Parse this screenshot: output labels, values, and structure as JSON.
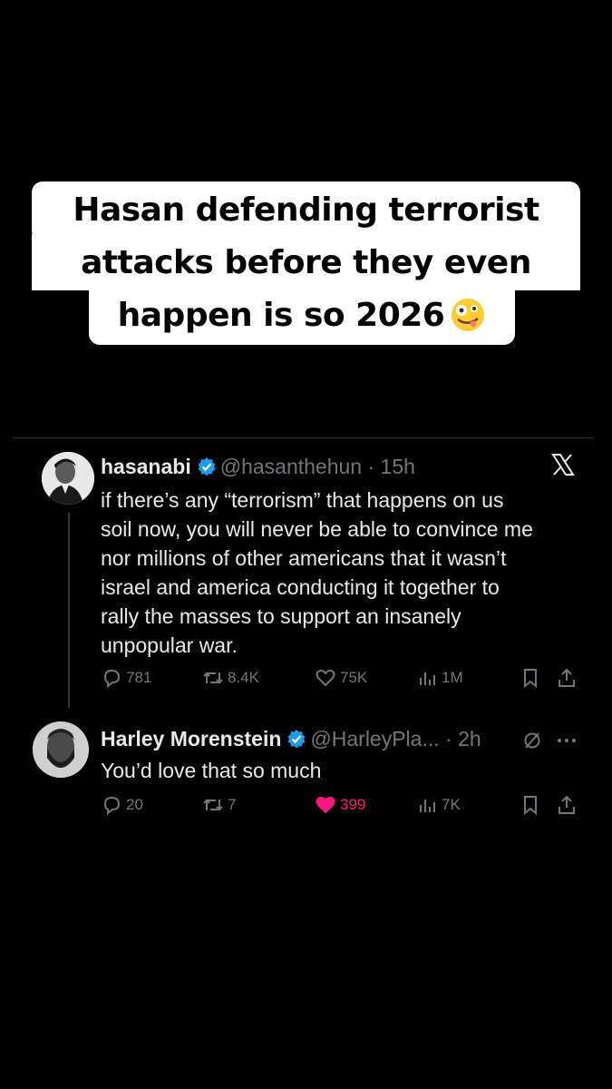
{
  "caption": {
    "line1": "Hasan defending terrorist",
    "line2": "attacks before they even",
    "line3": "happen is so 2026",
    "emoji": "zany-face-emoji"
  },
  "tweet": {
    "name": "hasanabi",
    "handle": "@hasanthehun",
    "time": "· 15h",
    "text_lines": [
      "if there’s any “terrorism” that happens on us",
      "soil now, you will never be able to convince me",
      "nor millions of other americans that it wasn’t",
      "israel and america conducting it together to",
      "rally the masses to support an insanely",
      "unpopular war."
    ],
    "replies": "781",
    "retweets": "8.4K",
    "likes": "75K",
    "views": "1M"
  },
  "reply": {
    "name": "Harley Morenstein",
    "handle": "@HarleyPla...",
    "time": "· 2h",
    "text": "You’d love that so much",
    "replies": "20",
    "retweets": "7",
    "likes": "399",
    "views": "7K"
  },
  "colors": {
    "background": "#000000",
    "text": "#e7e9ea",
    "secondary": "#71767b",
    "verified": "#1d9bf0",
    "like": "#f91880"
  }
}
